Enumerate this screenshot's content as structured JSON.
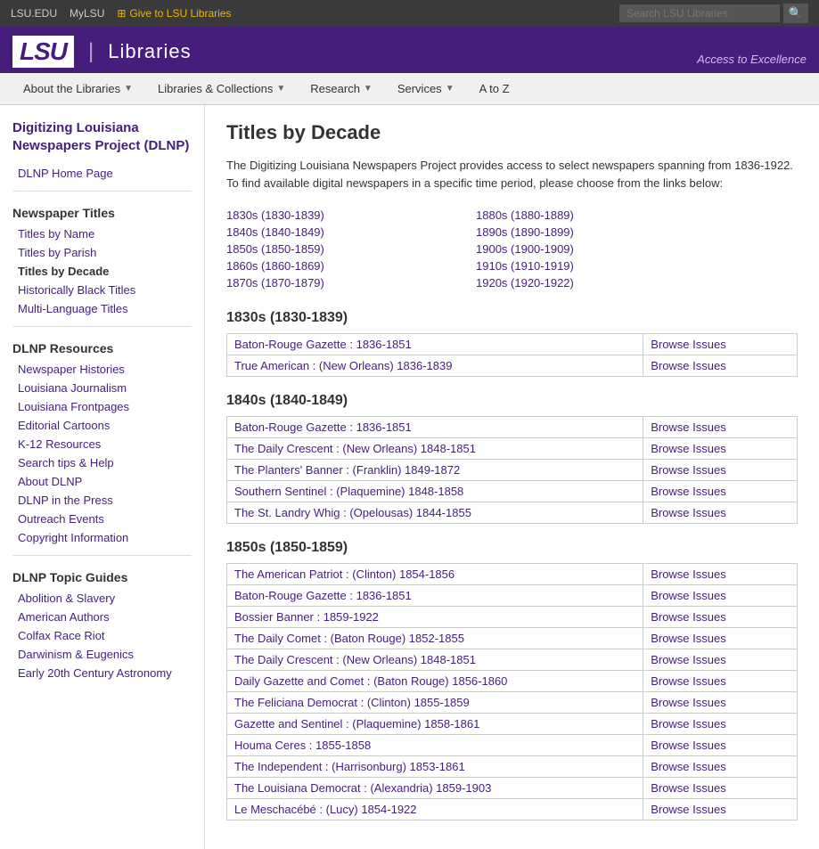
{
  "topbar": {
    "links": [
      {
        "label": "LSU.EDU",
        "href": "#"
      },
      {
        "label": "MyLSU",
        "href": "#"
      }
    ],
    "give_label": "Give to LSU Libraries",
    "search_placeholder": "Search LSU Libraries"
  },
  "header": {
    "logo_lsu": "LSU",
    "logo_separator": "|",
    "logo_libraries": "Libraries",
    "tagline": "Access to Excellence"
  },
  "nav": {
    "items": [
      {
        "label": "About the Libraries",
        "has_arrow": true
      },
      {
        "label": "Libraries & Collections",
        "has_arrow": true
      },
      {
        "label": "Research",
        "has_arrow": true
      },
      {
        "label": "Services",
        "has_arrow": true
      },
      {
        "label": "A to Z",
        "has_arrow": false
      }
    ]
  },
  "sidebar": {
    "project_title": "Digitizing Louisiana Newspapers Project (DLNP)",
    "home_link": "DLNP Home Page",
    "newspaper_titles_heading": "Newspaper Titles",
    "newspaper_title_links": [
      {
        "label": "Titles by Name",
        "active": false
      },
      {
        "label": "Titles by Parish",
        "active": false
      },
      {
        "label": "Titles by Decade",
        "active": true
      },
      {
        "label": "Historically Black Titles",
        "active": false
      },
      {
        "label": "Multi-Language Titles",
        "active": false
      }
    ],
    "resources_heading": "DLNP Resources",
    "resource_links": [
      {
        "label": "Newspaper Histories"
      },
      {
        "label": "Louisiana Journalism"
      },
      {
        "label": "Louisiana Frontpages"
      },
      {
        "label": "Editorial Cartoons"
      },
      {
        "label": "K-12 Resources"
      },
      {
        "label": "Search tips & Help"
      },
      {
        "label": "About DLNP"
      },
      {
        "label": "DLNP in the Press"
      },
      {
        "label": "Outreach Events"
      },
      {
        "label": "Copyright Information"
      }
    ],
    "topic_guides_heading": "DLNP Topic Guides",
    "topic_links": [
      {
        "label": "Abolition & Slavery"
      },
      {
        "label": "American Authors"
      },
      {
        "label": "Colfax Race Riot"
      },
      {
        "label": "Darwinism & Eugenics"
      },
      {
        "label": "Early 20th Century Astronomy"
      }
    ]
  },
  "content": {
    "page_title": "Titles by Decade",
    "intro": "The Digitizing Louisiana Newspapers Project provides access to select newspapers spanning from 1836-1922. To find available digital newspapers in a specific time period, please choose from the links below:",
    "decade_links": [
      {
        "label": "1830s (1830-1839)"
      },
      {
        "label": "1880s (1880-1889)"
      },
      {
        "label": "1840s (1840-1849)"
      },
      {
        "label": "1890s (1890-1899)"
      },
      {
        "label": "1850s (1850-1859)"
      },
      {
        "label": "1900s (1900-1909)"
      },
      {
        "label": "1860s (1860-1869)"
      },
      {
        "label": "1910s (1910-1919)"
      },
      {
        "label": "1870s (1870-1879)"
      },
      {
        "label": "1920s (1920-1922)"
      }
    ],
    "sections": [
      {
        "heading": "1830s (1830-1839)",
        "newspapers": [
          {
            "title": "Baton-Rouge Gazette : 1836-1851",
            "browse": "Browse Issues"
          },
          {
            "title": "True American : (New Orleans) 1836-1839",
            "browse": "Browse Issues"
          }
        ]
      },
      {
        "heading": "1840s (1840-1849)",
        "newspapers": [
          {
            "title": "Baton-Rouge Gazette : 1836-1851",
            "browse": "Browse Issues"
          },
          {
            "title": "The Daily Crescent : (New Orleans) 1848-1851",
            "browse": "Browse Issues"
          },
          {
            "title": "The Planters' Banner : (Franklin) 1849-1872",
            "browse": "Browse Issues"
          },
          {
            "title": "Southern Sentinel : (Plaquemine) 1848-1858",
            "browse": "Browse Issues"
          },
          {
            "title": "The St. Landry Whig : (Opelousas) 1844-1855",
            "browse": "Browse Issues"
          }
        ]
      },
      {
        "heading": "1850s (1850-1859)",
        "newspapers": [
          {
            "title": "The American Patriot : (Clinton) 1854-1856",
            "browse": "Browse Issues"
          },
          {
            "title": "Baton-Rouge Gazette : 1836-1851",
            "browse": "Browse Issues"
          },
          {
            "title": "Bossier Banner : 1859-1922",
            "browse": "Browse Issues"
          },
          {
            "title": "The Daily Comet : (Baton Rouge) 1852-1855",
            "browse": "Browse Issues"
          },
          {
            "title": "The Daily Crescent : (New Orleans) 1848-1851",
            "browse": "Browse Issues"
          },
          {
            "title": "Daily Gazette and Comet : (Baton Rouge) 1856-1860",
            "browse": "Browse Issues"
          },
          {
            "title": "The Feliciana Democrat : (Clinton) 1855-1859",
            "browse": "Browse Issues"
          },
          {
            "title": "Gazette and Sentinel : (Plaquemine) 1858-1861",
            "browse": "Browse Issues"
          },
          {
            "title": "Houma Ceres : 1855-1858",
            "browse": "Browse Issues"
          },
          {
            "title": "The Independent : (Harrisonburg) 1853-1861",
            "browse": "Browse Issues"
          },
          {
            "title": "The Louisiana Democrat : (Alexandria) 1859-1903",
            "browse": "Browse Issues"
          },
          {
            "title": "Le Meschacébé : (Lucy) 1854-1922",
            "browse": "Browse Issues"
          }
        ]
      }
    ]
  }
}
